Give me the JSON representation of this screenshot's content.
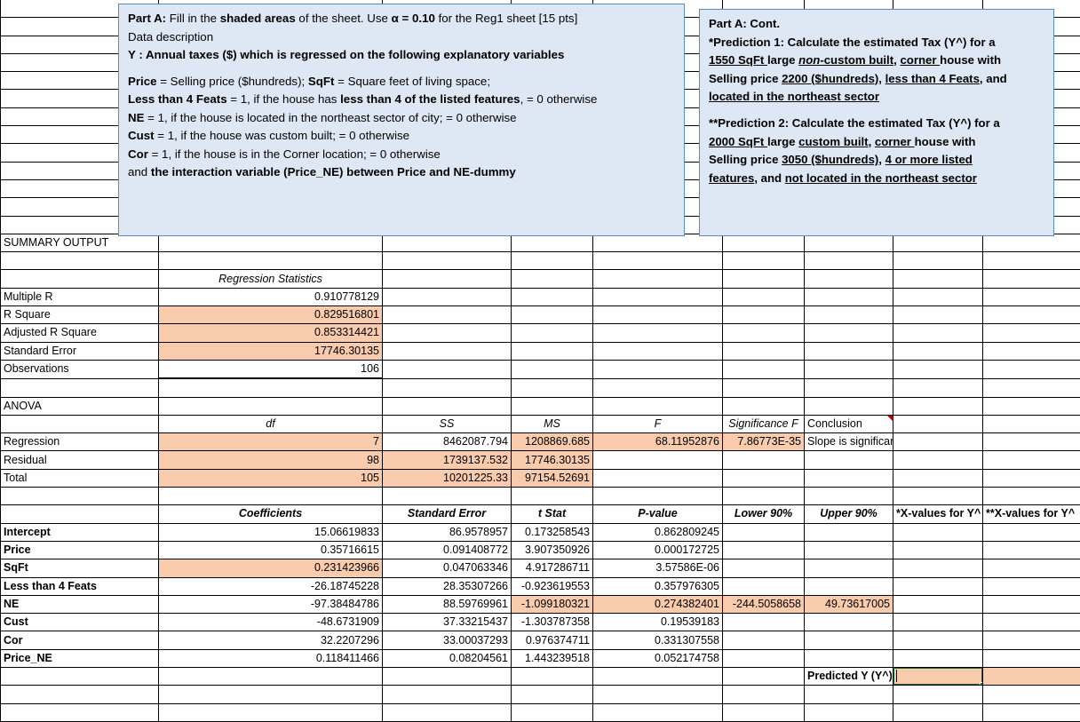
{
  "app": {
    "type": "spreadsheet",
    "accent_fill": "#F8CBAD",
    "textbox_fill": "#DEE8F4",
    "textbox_border": "#5B8DB8",
    "selection_color": "#1E6B39"
  },
  "textbox_left": {
    "name": "part-a-instructions",
    "line1_lead": "Part A:",
    "line1_a": " Fill in the ",
    "line1_b": "shaded areas",
    "line1_c": " of the sheet. Use ",
    "line1_alpha": "α = 0.10",
    "line1_d": " for the Reg1 sheet [15 pts]",
    "line2": "Data description",
    "line3": "Y : Annual taxes ($) which is regressed on the following explanatory variables",
    "line4_a": "Price",
    "line4_b": " = Selling price ($hundreds); ",
    "line4_c": "SqFt",
    "line4_d": " = Square feet of living space;",
    "line5_a": "Less than 4 Feats",
    "line5_b": " = 1, if the house has ",
    "line5_c": "less than 4 of the listed features",
    "line5_d": ", = 0 otherwise",
    "line6_a": "NE",
    "line6_b": " = 1, if the house is located in the northeast sector of city; = 0 otherwise",
    "line7_a": "Cust",
    "line7_b": " = 1, if the house was custom built; = 0 otherwise",
    "line8_a": "Cor",
    "line8_b": " = 1, if the house is in the Corner location; = 0 otherwise",
    "line9_a": "and ",
    "line9_b": "the interaction variable (Price_NE) between Price and NE-dummy"
  },
  "textbox_right": {
    "name": "part-a-cont-predictions",
    "title": "Part A: Cont.",
    "p1_line1": "*Prediction 1: Calculate the estimated Tax (Y^) for a",
    "p1_u1": "1550 SqFt ",
    "p1_t1": "large ",
    "p1_i1": "non",
    "p1_t2": "-custom built",
    "p1_t2b": ", ",
    "p1_u2": "corner ",
    "p1_t3": "house with",
    "p1_line3_a": "Selling price ",
    "p1_u3": "2200 ($hundreds)",
    "p1_t4": ", ",
    "p1_u4": "less than 4 Feats",
    "p1_t5": ", and",
    "p1_u5": "located in the northeast sector",
    "p2_line1": "**Prediction 2: Calculate the estimated Tax (Y^) for a",
    "p2_u1": "2000 SqFt ",
    "p2_t1": "large ",
    "p2_u2": "custom built",
    "p2_t2": ", ",
    "p2_u3": "corner ",
    "p2_t3": "house with",
    "p2_line3_a": "Selling price ",
    "p2_u4": "3050 ($hundreds)",
    "p2_t4": ", ",
    "p2_u5": "4 or more listed",
    "p2_u6": "features",
    "p2_t5": ", and ",
    "p2_u7": "not located in the northeast sector"
  },
  "sheet": {
    "summary_output_label": "SUMMARY OUTPUT",
    "regression_statistics": {
      "title": "Regression Statistics",
      "rows": [
        {
          "label": "Multiple R",
          "value": "0.910778129",
          "shaded": false
        },
        {
          "label": "R Square",
          "value": "0.829516801",
          "shaded": true
        },
        {
          "label": "Adjusted R Square",
          "value": "0.853314421",
          "shaded": true
        },
        {
          "label": "Standard Error",
          "value": "17746.30135",
          "shaded": true
        },
        {
          "label": "Observations",
          "value": "106",
          "shaded": false
        }
      ]
    },
    "anova": {
      "title": "ANOVA",
      "headers": [
        "df",
        "SS",
        "MS",
        "F",
        "Significance F",
        "Conclusion"
      ],
      "rows": [
        {
          "label": "Regression",
          "df": "7",
          "ss": "8462087.794",
          "ms": "1208869.685",
          "f": "68.11952876",
          "sig_f": "7.86773E-35",
          "conclusion": "Slope is significant"
        },
        {
          "label": "Residual",
          "df": "98",
          "ss": "1739137.532",
          "ms": "17746.30135",
          "f": "",
          "sig_f": "",
          "conclusion": ""
        },
        {
          "label": "Total",
          "df": "105",
          "ss": "10201225.33",
          "ms": "97154.52691",
          "f": "",
          "sig_f": "",
          "conclusion": ""
        }
      ]
    },
    "coefficients_table": {
      "headers": [
        "",
        "Coefficients",
        "Standard Error",
        "t Stat",
        "P-value",
        "Lower 90%",
        "Upper 90%",
        "*X-values for Y^",
        "**X-values for Y^"
      ],
      "rows": [
        {
          "label": "Intercept",
          "coef": "15.06619833",
          "se": "86.9578957",
          "t": "0.173258543",
          "p": "0.862809245",
          "lower": "",
          "upper": "",
          "x1": "",
          "x2": ""
        },
        {
          "label": "Price",
          "coef": "0.35716615",
          "se": "0.091408772",
          "t": "3.907350926",
          "p": "0.000172725",
          "lower": "",
          "upper": "",
          "x1": "",
          "x2": ""
        },
        {
          "label": "SqFt",
          "coef": "0.231423966",
          "se": "0.047063346",
          "t": "4.917286711",
          "p": "3.57586E-06",
          "lower": "",
          "upper": "",
          "x1": "",
          "x2": ""
        },
        {
          "label": "Less than 4 Feats",
          "coef": "-26.18745228",
          "se": "28.35307266",
          "t": "-0.923619553",
          "p": "0.357976305",
          "lower": "",
          "upper": "",
          "x1": "",
          "x2": ""
        },
        {
          "label": "NE",
          "coef": "-97.38484786",
          "se": "88.59769961",
          "t": "-1.099180321",
          "p": "0.274382401",
          "lower": "-244.5058658",
          "upper": "49.73617005",
          "x1": "",
          "x2": ""
        },
        {
          "label": "Cust",
          "coef": "-48.6731909",
          "se": "37.33215437",
          "t": "-1.303787358",
          "p": "0.19539183",
          "lower": "",
          "upper": "",
          "x1": "",
          "x2": ""
        },
        {
          "label": "Cor",
          "coef": "32.2207296",
          "se": "33.00037293",
          "t": "0.976374711",
          "p": "0.331307558",
          "lower": "",
          "upper": "",
          "x1": "",
          "x2": ""
        },
        {
          "label": "Price_NE",
          "coef": "0.118411466",
          "se": "0.08204561",
          "t": "1.443239518",
          "p": "0.052174758",
          "lower": "",
          "upper": "",
          "x1": "",
          "x2": ""
        }
      ]
    },
    "predicted_row": {
      "label": "Predicted Y (Y^)",
      "value1": "",
      "value2": ""
    }
  }
}
